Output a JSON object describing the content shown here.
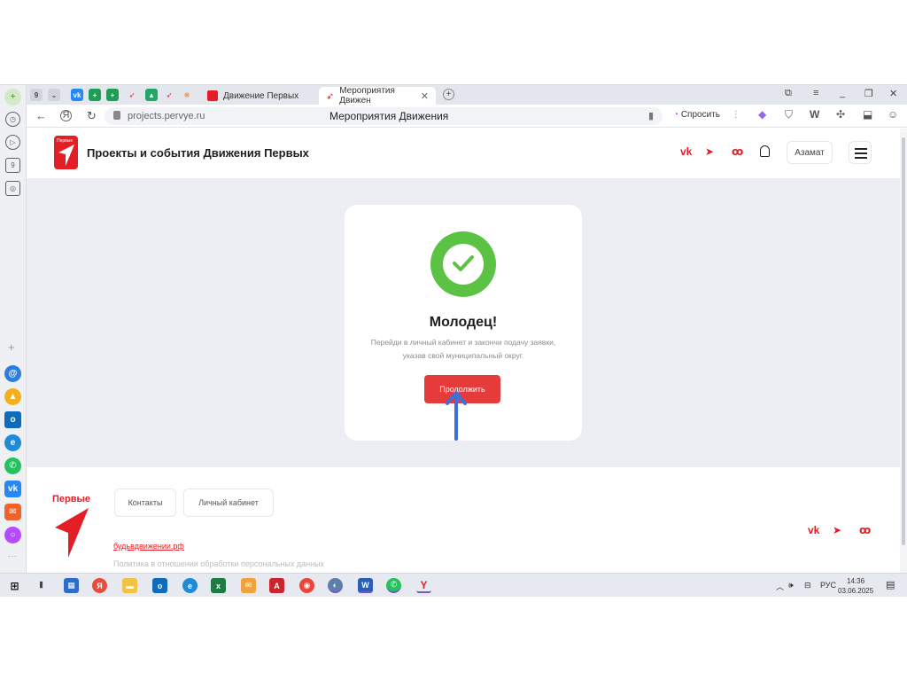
{
  "browser": {
    "tabs": [
      {
        "label": "Движение Первых"
      },
      {
        "label": "Мероприятия Движен",
        "active": true
      }
    ],
    "tab_count": "9",
    "new_tab": "+",
    "url": "projects.pervye.ru",
    "page_title": "Мероприятия Движения",
    "ask_label": "Спросить",
    "ext_w": "W"
  },
  "sidebar": {
    "badge": "9"
  },
  "site": {
    "title": "Проекты и события Движения Первых",
    "user_name": "Азамат",
    "social": [
      "vk",
      "telegram",
      "ok"
    ]
  },
  "card": {
    "title": "Молодец!",
    "text": "Перейди в личный кабинет и закончи подачу заявки, указав свой муниципальный округ.",
    "button": "Продолжить"
  },
  "footer": {
    "logo_text": "Первые",
    "buttons": [
      "Контакты",
      "Личный кабинет"
    ],
    "link": "будьвдвижении.рф",
    "policy": "Политика в отношении обработки персональных данных"
  },
  "taskbar": {
    "lang": "РУС",
    "time": "14:36",
    "date": "03.06.2025"
  },
  "colors": {
    "brand_red": "#e31e24",
    "success_green": "#5cc244",
    "annotation_blue": "#3f6fd8"
  }
}
